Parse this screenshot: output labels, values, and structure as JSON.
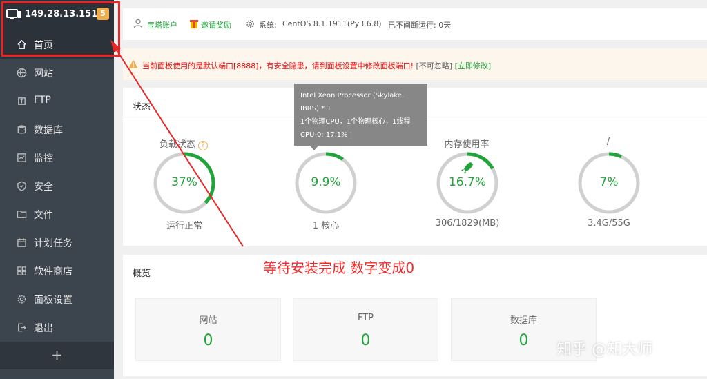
{
  "sidebar": {
    "server_ip": "149.28.13.151",
    "badge_count": "5",
    "items": [
      {
        "label": "首页",
        "icon": "home-icon"
      },
      {
        "label": "网站",
        "icon": "globe-icon"
      },
      {
        "label": "FTP",
        "icon": "ftp-icon"
      },
      {
        "label": "数据库",
        "icon": "database-icon"
      },
      {
        "label": "监控",
        "icon": "monitor-icon"
      },
      {
        "label": "安全",
        "icon": "shield-icon"
      },
      {
        "label": "文件",
        "icon": "folder-icon"
      },
      {
        "label": "计划任务",
        "icon": "calendar-icon"
      },
      {
        "label": "软件商店",
        "icon": "grid-icon"
      },
      {
        "label": "面板设置",
        "icon": "gear-icon"
      },
      {
        "label": "退出",
        "icon": "logout-icon"
      }
    ],
    "add_label": "+"
  },
  "topbar": {
    "account": "宝塔账户",
    "invite": "邀请奖励",
    "system_label": "系统:",
    "system_value": "CentOS 8.1.1911(Py3.6.8)",
    "uptime": "已不间断运行: 0天"
  },
  "warning": {
    "text": "当前面板使用的是默认端口[8888]，有安全隐患，请到面板设置中修改面板端口!",
    "ignore": "[不可忽略]",
    "fix": "[立即修改]"
  },
  "status": {
    "title": "状态",
    "gauges": [
      {
        "title": "负载状态",
        "value": "37%",
        "percent": 37,
        "sub": "运行正常"
      },
      {
        "title": "",
        "value": "9.9%",
        "percent": 9.9,
        "sub": "1 核心"
      },
      {
        "title": "内存使用率",
        "value": "16.7%",
        "percent": 16.7,
        "sub": "306/1829(MB)"
      },
      {
        "title": "/",
        "value": "7%",
        "percent": 7,
        "sub": "3.4G/55G"
      }
    ]
  },
  "tooltip": {
    "line1": "Intel Xeon Processor (Skylake,",
    "line2": "IBRS) * 1",
    "line3": "1个物理CPU，1个物理核心，1线程",
    "line4": "CPU-0: 17.1% |"
  },
  "overview": {
    "title": "概览",
    "cards": [
      {
        "label": "网站",
        "value": "0"
      },
      {
        "label": "FTP",
        "value": "0"
      },
      {
        "label": "数据库",
        "value": "0"
      }
    ]
  },
  "annotation": {
    "text": "等待安装完成  数字变成0"
  },
  "watermark": "知乎 @知大师",
  "colors": {
    "accent_green": "#20a53a",
    "sidebar_bg": "#3c444d",
    "annotation_red": "#e62727",
    "badge_orange": "#f0ad4e"
  }
}
